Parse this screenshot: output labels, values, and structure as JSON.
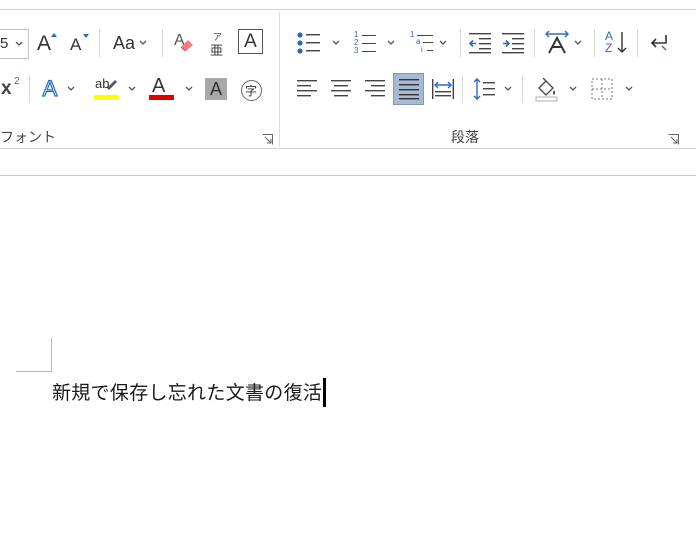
{
  "ribbon": {
    "font_group_label": "フォント",
    "paragraph_group_label": "段落",
    "font_size_value": "5",
    "grow_font_glyph": "A",
    "shrink_font_glyph": "A",
    "change_case_glyph": "Aa",
    "superscript_glyph": "x",
    "superscript_mark": "2",
    "phonetic_top": "ア",
    "phonetic_bottom": "亜",
    "char_border_glyph": "A",
    "text_effect_glyph": "A",
    "highlight_glyph": "ab",
    "font_color_glyph": "A",
    "char_shading_glyph": "A",
    "enclose_char_glyph": "字",
    "sort_top": "A",
    "sort_bottom": "Z",
    "numbering_digits": [
      "1",
      "2",
      "3"
    ],
    "multilevel_marks": [
      "1",
      "a",
      "i"
    ],
    "colors": {
      "highlight": "#ffff00",
      "font_color": "#e00000",
      "accent_blue": "#2b6cbf",
      "justify_active_bg": "#a6bad6"
    }
  },
  "document": {
    "text": "新規で保存し忘れた文書の復活"
  }
}
